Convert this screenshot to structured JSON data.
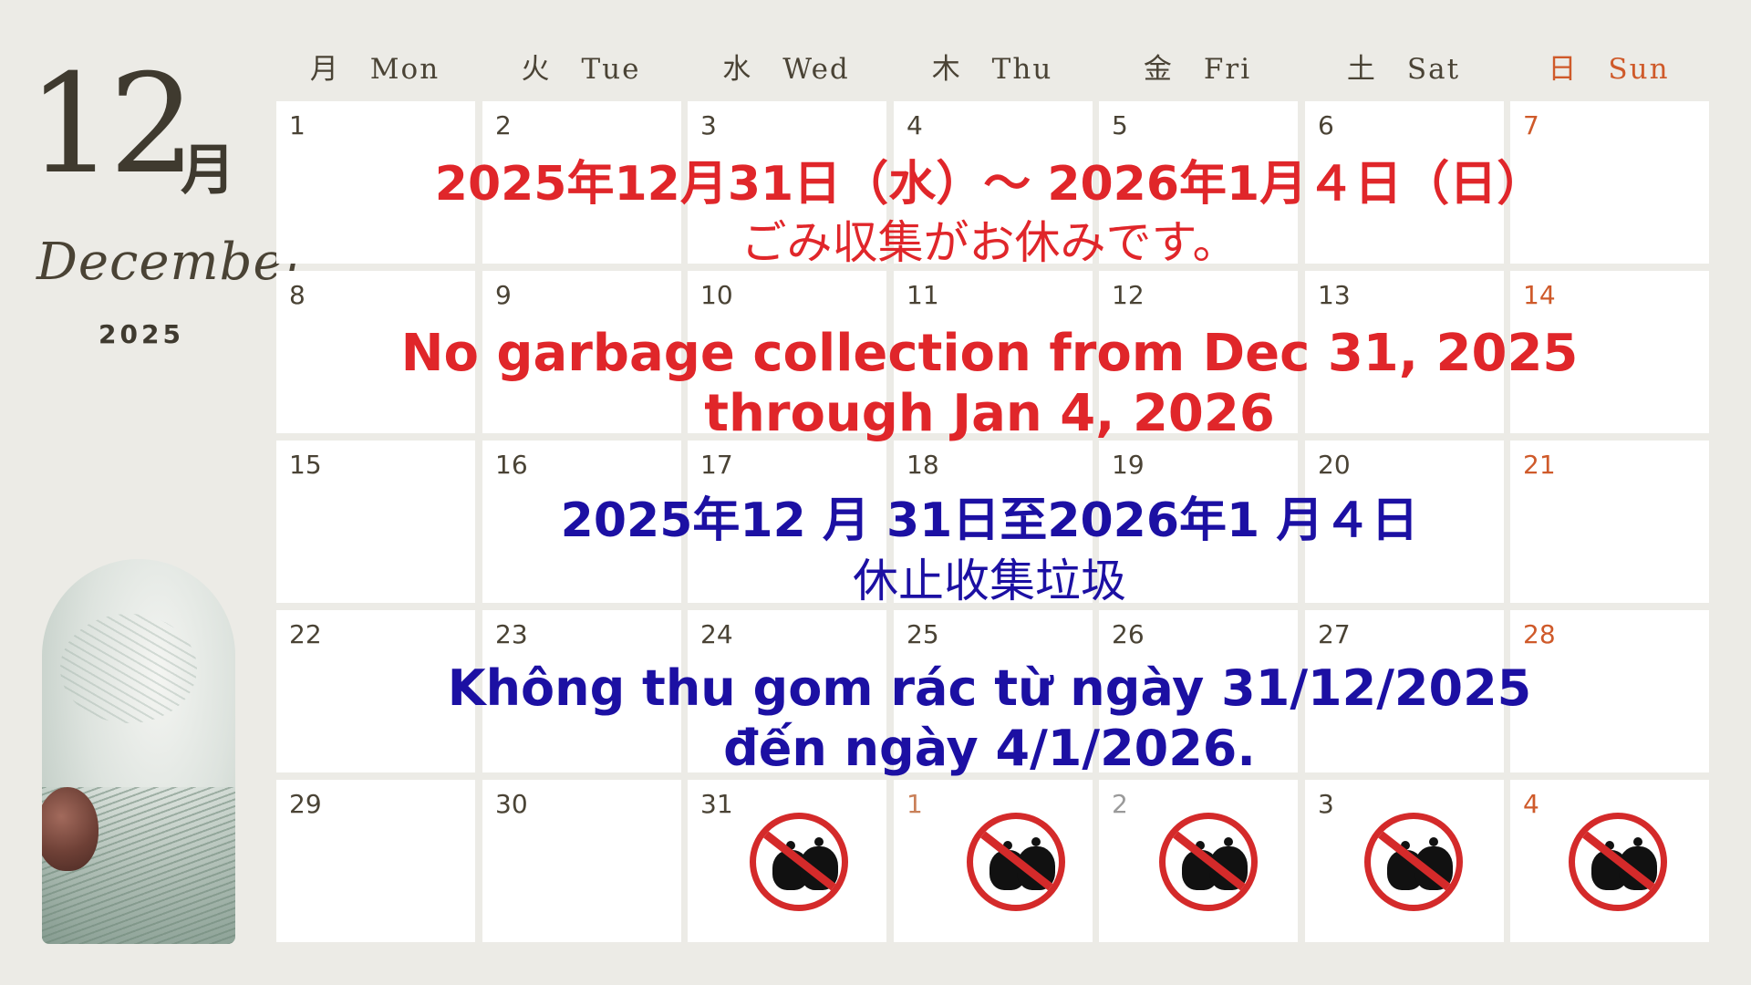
{
  "side": {
    "month_num": "12",
    "month_kanji": "月",
    "month_en": "December",
    "year": "2025"
  },
  "headers": [
    {
      "label": "月　Mon"
    },
    {
      "label": "火　Tue"
    },
    {
      "label": "水　Wed"
    },
    {
      "label": "木　Thu"
    },
    {
      "label": "金　Fri"
    },
    {
      "label": "土　Sat"
    },
    {
      "label": "日　Sun"
    }
  ],
  "weeks": [
    [
      "1",
      "2",
      "3",
      "4",
      "5",
      "6",
      "7"
    ],
    [
      "8",
      "9",
      "10",
      "11",
      "12",
      "13",
      "14"
    ],
    [
      "15",
      "16",
      "17",
      "18",
      "19",
      "20",
      "21"
    ],
    [
      "22",
      "23",
      "24",
      "25",
      "26",
      "27",
      "28"
    ],
    [
      "29",
      "30",
      "31",
      "1",
      "2",
      "3",
      "4"
    ]
  ],
  "notices": {
    "ja_line1": "2025年12月31日（水）～ 2026年1月４日（日）",
    "ja_line2": "ごみ収集がお休みです。",
    "en_line1": "No garbage collection from Dec 31, 2025",
    "en_line2": "through Jan 4, 2026",
    "zh_line1": "2025年12 月 31日至2026年1 月４日",
    "zh_line2": "休止收集垃圾",
    "vi_line1": "Không thu gom rác từ ngày 31/12/2025",
    "vi_line2": "đến ngày 4/1/2026."
  },
  "colors": {
    "background": "#ecebe6",
    "red": "#e0262a",
    "blue": "#1c10a3",
    "sunday": "#cf5a2a"
  },
  "icons": {
    "no_garbage": "no-garbage-collection-icon"
  }
}
